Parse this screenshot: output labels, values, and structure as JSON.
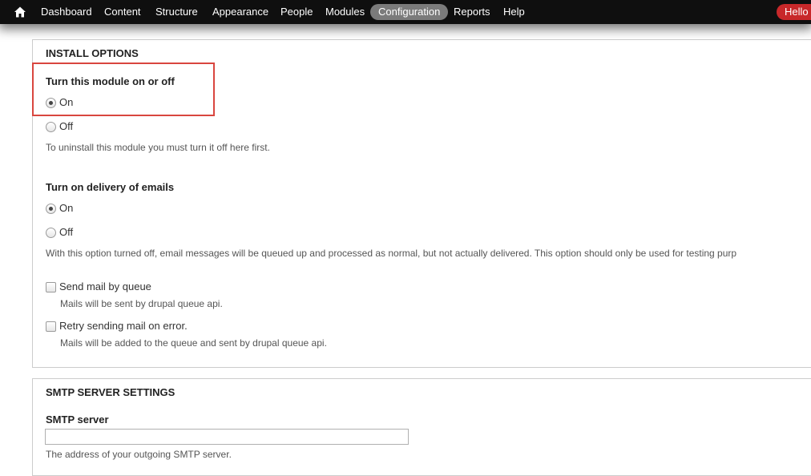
{
  "toolbar": {
    "home_icon": "home-icon",
    "items": [
      {
        "label": "Dashboard"
      },
      {
        "label": "Content"
      },
      {
        "label": "Structure"
      },
      {
        "label": "Appearance"
      },
      {
        "label": "People"
      },
      {
        "label": "Modules"
      },
      {
        "label": "Configuration",
        "active": true
      },
      {
        "label": "Reports"
      },
      {
        "label": "Help"
      }
    ],
    "user_greeting": "Hello a",
    "active_color": "#7b7b7b",
    "greeting_color": "#c8282a"
  },
  "install_options": {
    "legend": "INSTALL OPTIONS",
    "module_toggle": {
      "label": "Turn this module on or off",
      "options": [
        {
          "label": "On",
          "checked": true
        },
        {
          "label": "Off",
          "checked": false
        }
      ],
      "description": "To uninstall this module you must turn it off here first."
    },
    "delivery": {
      "label": "Turn on delivery of emails",
      "options": [
        {
          "label": "On",
          "checked": true
        },
        {
          "label": "Off",
          "checked": false
        }
      ],
      "description": "With this option turned off, email messages will be queued up and processed as normal, but not actually delivered. This option should only be used for testing purp"
    },
    "queue": {
      "label": "Send mail by queue",
      "checked": false,
      "description": "Mails will be sent by drupal queue api."
    },
    "retry": {
      "label": "Retry sending mail on error.",
      "checked": false,
      "description": "Mails will be added to the queue and sent by drupal queue api."
    },
    "highlight_color": "#d9463f"
  },
  "smtp_settings": {
    "legend": "SMTP SERVER SETTINGS",
    "server": {
      "label": "SMTP server",
      "value": "",
      "description": "The address of your outgoing SMTP server."
    }
  }
}
